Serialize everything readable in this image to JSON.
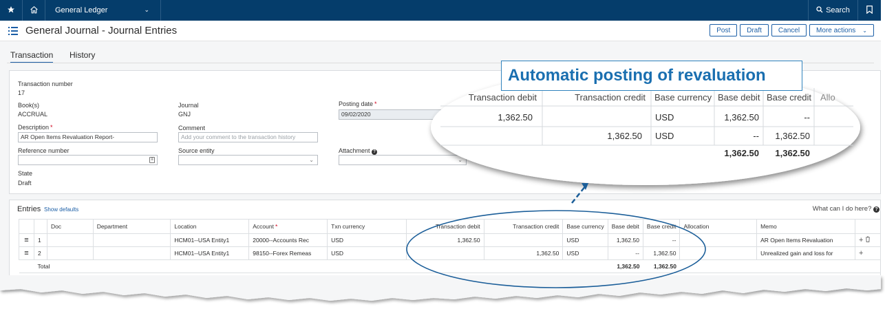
{
  "topbar": {
    "module_label": "General Ledger",
    "search_label": "Search"
  },
  "header": {
    "page_title": "General Journal - Journal Entries",
    "actions": {
      "post": "Post",
      "draft": "Draft",
      "cancel": "Cancel",
      "more": "More actions"
    }
  },
  "tabs": {
    "transaction": "Transaction",
    "history": "History"
  },
  "form": {
    "transaction_number": {
      "label": "Transaction number",
      "value": "17"
    },
    "books": {
      "label": "Book(s)",
      "value": "ACCRUAL"
    },
    "journal": {
      "label": "Journal",
      "value": "GNJ"
    },
    "posting_date": {
      "label": "Posting date",
      "value": "09/02/2020"
    },
    "description": {
      "label": "Description",
      "value": "AR Open Items Revaluation Report-"
    },
    "comment": {
      "label": "Comment",
      "placeholder": "Add your comment to the transaction history"
    },
    "reference_number": {
      "label": "Reference number",
      "value": ""
    },
    "source_entity": {
      "label": "Source entity",
      "value": ""
    },
    "attachment": {
      "label": "Attachment",
      "value": ""
    },
    "state": {
      "label": "State",
      "value": "Draft"
    }
  },
  "entries": {
    "title": "Entries",
    "show_defaults": "Show defaults",
    "help": "What can I do here?",
    "columns": [
      "",
      "",
      "Doc",
      "Department",
      "Location",
      "Account",
      "Txn currency",
      "Transaction debit",
      "Transaction credit",
      "Base currency",
      "Base debit",
      "Base credit",
      "Allocation",
      "Memo",
      ""
    ],
    "rows": [
      {
        "num": "1",
        "doc": "",
        "department": "",
        "location": "HCM01--USA Entity1",
        "account": "20000--Accounts Rec",
        "txn_currency": "USD",
        "txn_debit": "1,362.50",
        "txn_credit": "",
        "base_currency": "USD",
        "base_debit": "1,362.50",
        "base_credit": "--",
        "allocation": "",
        "memo": "AR Open Items Revaluation"
      },
      {
        "num": "2",
        "doc": "",
        "department": "",
        "location": "HCM01--USA Entity1",
        "account": "98150--Forex Remeas",
        "txn_currency": "USD",
        "txn_debit": "",
        "txn_credit": "1,362.50",
        "base_currency": "USD",
        "base_debit": "--",
        "base_credit": "1,362.50",
        "allocation": "",
        "memo": "Unrealized gain and loss for"
      }
    ],
    "total": {
      "label": "Total",
      "base_debit": "1,362.50",
      "base_credit": "1,362.50"
    }
  },
  "callout": {
    "title": "Automatic posting of revaluation",
    "headers": [
      "Transaction debit",
      "Transaction credit",
      "Base currency",
      "Base debit",
      "Base credit",
      "Allo"
    ],
    "row1": [
      "1,362.50",
      "",
      "USD",
      "1,362.50",
      "--"
    ],
    "row2": [
      "",
      "1,362.50",
      "USD",
      "--",
      "1,362.50"
    ],
    "totals": [
      "1,362.50",
      "1,362.50"
    ]
  },
  "colors": {
    "nav_bg": "#053d6b",
    "accent": "#1b5ea6",
    "callout_blue": "#1a6fb0",
    "required": "#d0021b"
  }
}
